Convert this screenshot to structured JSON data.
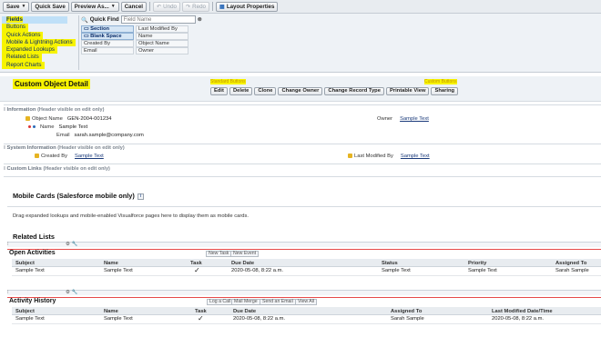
{
  "toolbar": {
    "save": "Save",
    "quick_save": "Quick Save",
    "preview_as": "Preview As...",
    "cancel": "Cancel",
    "undo": "Undo",
    "redo": "Redo",
    "layout_properties": "Layout Properties"
  },
  "palette": {
    "categories": [
      "Fields",
      "Buttons",
      "Quick Actions",
      "Mobile & Lightning Actions",
      "Expanded Lookups",
      "Related Lists",
      "Report Charts"
    ],
    "quick_find_label": "Quick Find",
    "quick_find_placeholder": "Field Name",
    "items": [
      "Section",
      "Last Modified By",
      "Blank Space",
      "Name",
      "Created By",
      "Object Name",
      "Email",
      "Owner"
    ]
  },
  "header": {
    "title": "Custom Object Detail",
    "standard_buttons_label": "Standard Buttons",
    "custom_buttons_label": "Custom Buttons",
    "buttons": [
      "Edit",
      "Delete",
      "Clone",
      "Change Owner",
      "Change Record Type",
      "Printable View",
      "Sharing"
    ]
  },
  "information": {
    "heading": "Information",
    "note": "(Header visible on edit only)",
    "object_name_label": "Object Name",
    "object_name_value": "GEN-2004-001234",
    "name_label": "Name",
    "name_value": "Sample Text",
    "email_label": "Email",
    "email_value": "sarah.sample@company.com",
    "owner_label": "Owner",
    "owner_value": "Sample Text"
  },
  "system_information": {
    "heading": "System Information",
    "note": "(Header visible on edit only)",
    "created_by_label": "Created By",
    "created_by_value": "Sample Text",
    "last_modified_label": "Last Modified By",
    "last_modified_value": "Sample Text"
  },
  "custom_links": {
    "heading": "Custom Links",
    "note": "(Header visible on edit only)"
  },
  "mobile_cards": {
    "heading": "Mobile Cards (Salesforce mobile only)",
    "info_icon": "i",
    "description": "Drag expanded lookups and mobile-enabled Visualforce pages here to display them as mobile cards."
  },
  "related_lists": {
    "heading": "Related Lists",
    "open_activities": {
      "title": "Open Activities",
      "buttons": [
        "New Task",
        "New Event"
      ],
      "columns": [
        "Subject",
        "Name",
        "Task",
        "Due Date",
        "Status",
        "Priority",
        "Assigned To"
      ],
      "row": [
        "Sample Text",
        "Sample Text",
        "✓",
        "2020-05-08, 8:22 a.m.",
        "Sample Text",
        "Sample Text",
        "Sarah Sample"
      ]
    },
    "activity_history": {
      "title": "Activity History",
      "buttons": [
        "Log a Call",
        "Mail Merge",
        "Send an Email",
        "View All"
      ],
      "columns": [
        "Subject",
        "Name",
        "Task",
        "Due Date",
        "Assigned To",
        "Last Modified Date/Time"
      ],
      "row": [
        "Sample Text",
        "Sample Text",
        "✓",
        "2020-05-08, 8:22 a.m.",
        "Sarah Sample",
        "2020-05-08, 8:22 a.m."
      ]
    }
  },
  "colors": {
    "highlight": "#f7f300",
    "accent_red": "#e64a4a",
    "link": "#1a3a7a"
  }
}
